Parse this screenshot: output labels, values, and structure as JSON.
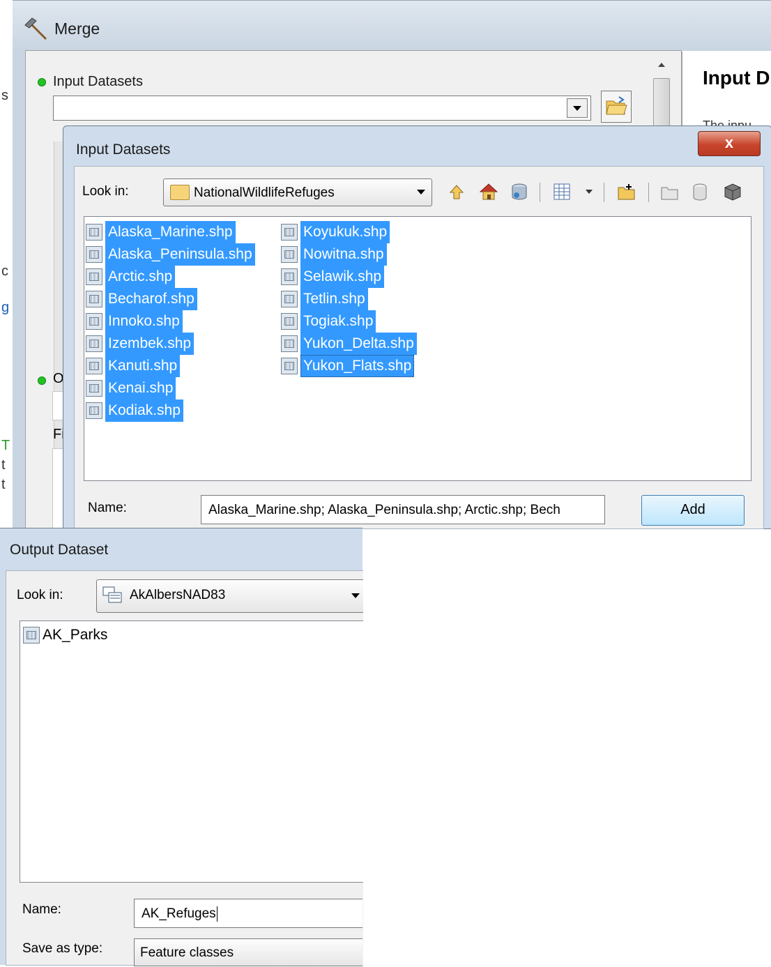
{
  "merge": {
    "title": "Merge",
    "input_datasets_label": "Input Datasets",
    "output_dataset_label_fragment": "O",
    "fields_label_fragment": "Fi",
    "help_title": "Input D",
    "help_snippet": "The inpu",
    "left_edge_chars": [
      "s",
      "c",
      "g",
      "T",
      "t",
      "t"
    ]
  },
  "input_dialog": {
    "title": "Input Datasets",
    "close_label": "x",
    "look_in_label": "Look in:",
    "look_in_value": "NationalWildlifeRefuges",
    "toolbar": [
      "up-one-level-icon",
      "home-icon",
      "database-connect-icon",
      "view-menu-icon",
      "new-folder-icon",
      "new-folder-gray-icon",
      "new-table-icon",
      "new-toolbox-icon"
    ],
    "files_col1": [
      "Alaska_Marine.shp",
      "Alaska_Peninsula.shp",
      "Arctic.shp",
      "Becharof.shp",
      "Innoko.shp",
      "Izembek.shp",
      "Kanuti.shp",
      "Kenai.shp",
      "Kodiak.shp"
    ],
    "files_col2": [
      "Koyukuk.shp",
      "Nowitna.shp",
      "Selawik.shp",
      "Tetlin.shp",
      "Togiak.shp",
      "Yukon_Delta.shp",
      "Yukon_Flats.shp"
    ],
    "name_label": "Name:",
    "name_value": "Alaska_Marine.shp; Alaska_Peninsula.shp; Arctic.shp; Bech",
    "add_label": "Add",
    "selection_color": "#3399ff"
  },
  "output_dialog": {
    "title": "Output Dataset",
    "look_in_label": "Look in:",
    "look_in_value": "AkAlbersNAD83",
    "items": [
      "AK_Parks"
    ],
    "name_label": "Name:",
    "name_value": "AK_Refuges",
    "save_type_label": "Save as type:",
    "save_type_value": "Feature classes"
  }
}
